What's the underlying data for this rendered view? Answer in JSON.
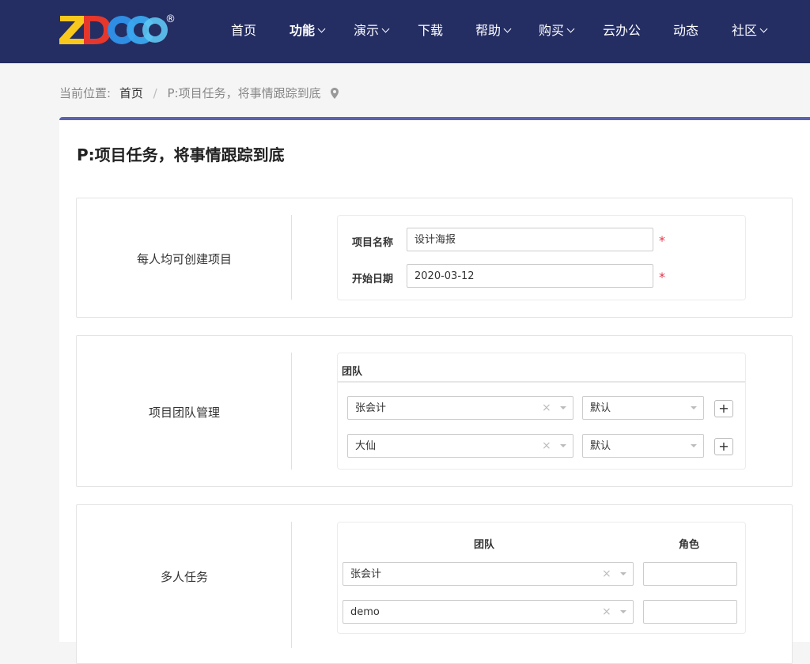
{
  "brand": {
    "logo_text": "ZDOO",
    "registered": "®"
  },
  "nav": [
    {
      "label": "首页",
      "dropdown": false,
      "active": false
    },
    {
      "label": "功能",
      "dropdown": true,
      "active": true
    },
    {
      "label": "演示",
      "dropdown": true,
      "active": false
    },
    {
      "label": "下载",
      "dropdown": false,
      "active": false
    },
    {
      "label": "帮助",
      "dropdown": true,
      "active": false
    },
    {
      "label": "购买",
      "dropdown": true,
      "active": false
    },
    {
      "label": "云办公",
      "dropdown": false,
      "active": false
    },
    {
      "label": "动态",
      "dropdown": false,
      "active": false
    },
    {
      "label": "社区",
      "dropdown": true,
      "active": false
    }
  ],
  "breadcrumb": {
    "prefix": "当前位置:",
    "home": "首页",
    "separator": "/",
    "current": "P:项目任务，将事情跟踪到底",
    "icon": "location-pin-icon"
  },
  "page_title": "P:项目任务，将事情跟踪到底",
  "sections": {
    "create": {
      "label": "每人均可创建项目",
      "name_label": "项目名称",
      "name_value": "设计海报",
      "date_label": "开始日期",
      "date_value": "2020-03-12",
      "required_mark": "*"
    },
    "team": {
      "label": "项目团队管理",
      "heading": "团队",
      "rows": [
        {
          "member": "张会计",
          "role": "默认",
          "clear": "×",
          "add": "+"
        },
        {
          "member": "大仙",
          "role": "默认",
          "clear": "×",
          "add": "+"
        }
      ]
    },
    "multi": {
      "label": "多人任务",
      "col_team": "团队",
      "col_role": "角色",
      "rows": [
        {
          "member": "张会计",
          "clear": "×",
          "role": ""
        },
        {
          "member": "demo",
          "clear": "×",
          "role": ""
        }
      ]
    }
  },
  "colors": {
    "nav_bg": "#242e63",
    "card_accent": "#5b62b0",
    "required": "#e2364b"
  }
}
